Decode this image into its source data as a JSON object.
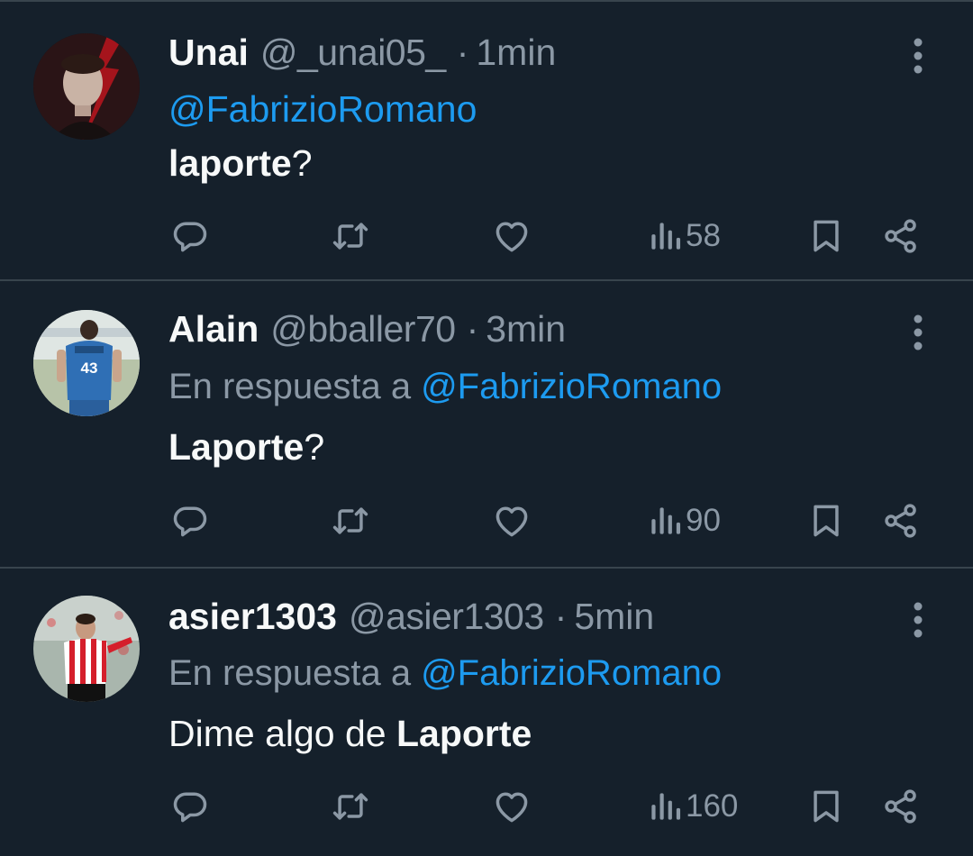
{
  "colors": {
    "background": "#15202b",
    "divider": "#38444d",
    "primary_text": "#f7f9f9",
    "secondary_text": "#8b98a5",
    "link": "#1d9bf0"
  },
  "icons": {
    "reply": "speech-bubble-icon",
    "retweet": "retweet-arrows-icon",
    "like": "heart-outline-icon",
    "views": "bar-chart-icon",
    "bookmark": "bookmark-outline-icon",
    "share": "share-nodes-icon",
    "more": "vertical-dots-icon"
  },
  "tweets": [
    {
      "name": "Unai",
      "handle": "@_unai05_",
      "separator": "·",
      "time": "1min",
      "mention": "@FabrizioRomano",
      "body_bold": "laporte",
      "body_rest": "?",
      "views": "58"
    },
    {
      "name": "Alain",
      "handle": "@bballer70",
      "separator": "·",
      "time": "3min",
      "reply_prefix": "En respuesta a",
      "mention": "@FabrizioRomano",
      "body_bold": "Laporte",
      "body_rest": "?",
      "views": "90"
    },
    {
      "name": "asier1303",
      "handle": "@asier1303",
      "separator": "·",
      "time": "5min",
      "reply_prefix": "En respuesta a",
      "mention": "@FabrizioRomano",
      "body_plain": "Dime algo de",
      "body_bold": "Laporte",
      "views": "160"
    }
  ]
}
